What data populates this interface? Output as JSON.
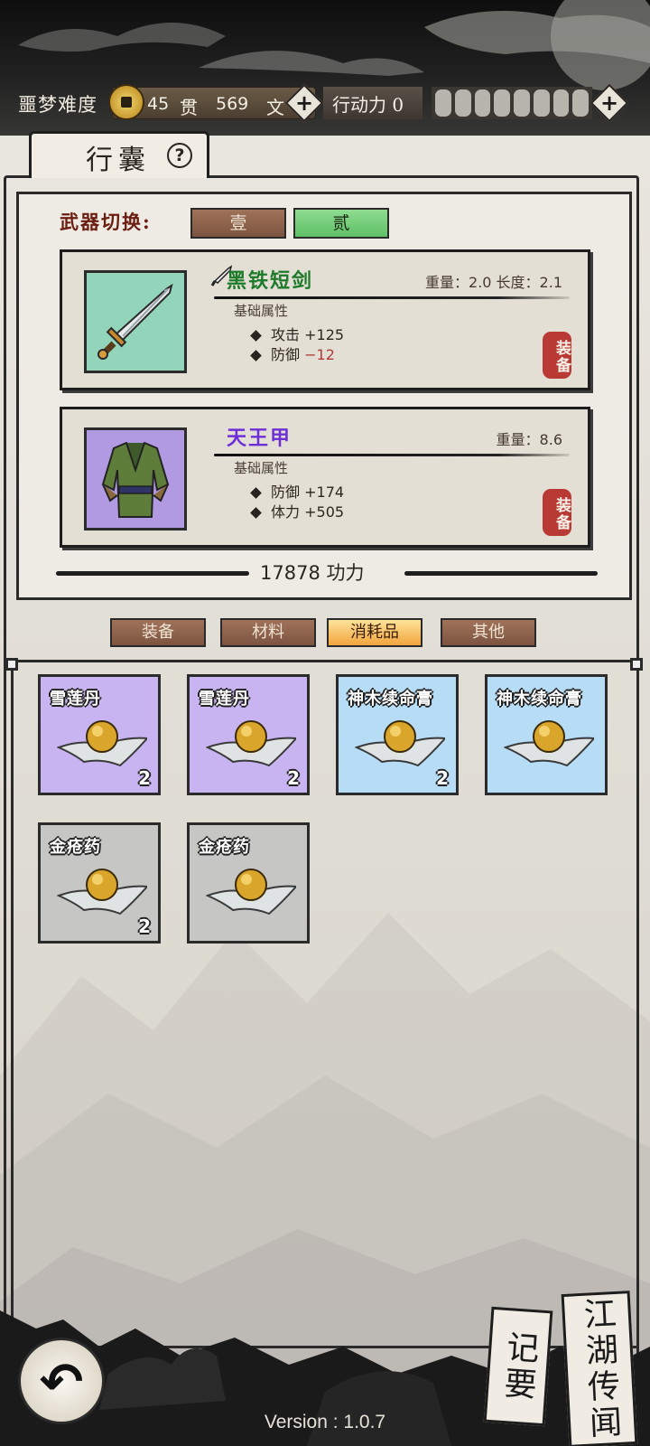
{
  "hud": {
    "difficulty": "噩梦难度",
    "coins_guan": "45",
    "coins_guan_unit": "贯",
    "coins_wen": "569",
    "coins_wen_unit": "文",
    "action_label": "行动力 0",
    "stamina_filled": 0,
    "stamina_slots": 8
  },
  "panel": {
    "title": "行囊",
    "help": "?",
    "weapon_switch_label": "武器切换:",
    "weapon_slots": [
      {
        "label": "壹",
        "active": false
      },
      {
        "label": "贰",
        "active": true
      }
    ]
  },
  "equipped": [
    {
      "name": "黑铁短剑",
      "meta": "重量：2.0  长度：2.1",
      "subtitle": "基础属性",
      "stats": [
        {
          "label": "攻击",
          "value": "+125"
        },
        {
          "label": "防御",
          "value": "−12"
        }
      ],
      "seal": "装备",
      "icon": "sword-icon",
      "color": "#93d5ba"
    },
    {
      "name": "天王甲",
      "meta": "重量：8.6",
      "subtitle": "基础属性",
      "stats": [
        {
          "label": "防御",
          "value": "+174"
        },
        {
          "label": "体力",
          "value": "+505"
        }
      ],
      "seal": "装备",
      "icon": "armor-icon",
      "color": "#b29ae2"
    }
  ],
  "power": "17878 功力",
  "categories": [
    {
      "label": "装备",
      "active": false
    },
    {
      "label": "材料",
      "active": false
    },
    {
      "label": "消耗品",
      "active": true
    },
    {
      "label": "其他",
      "active": false
    }
  ],
  "inventory": [
    {
      "name": "雪莲丹",
      "count": "2",
      "rarity": "purple",
      "icon": "pill-icon"
    },
    {
      "name": "雪莲丹",
      "count": "2",
      "rarity": "purple",
      "icon": "pill-icon"
    },
    {
      "name": "神木续命膏",
      "count": "2",
      "rarity": "blue",
      "icon": "pill-icon"
    },
    {
      "name": "神木续命膏",
      "count": "",
      "rarity": "blue",
      "icon": "pill-icon"
    },
    {
      "name": "金疮药",
      "count": "2",
      "rarity": "gray",
      "icon": "pill-icon"
    },
    {
      "name": "金疮药",
      "count": "",
      "rarity": "gray",
      "icon": "pill-icon"
    }
  ],
  "bottom": {
    "back_icon": "back-arrow-icon",
    "back_glyph": "↶",
    "notes": "记要",
    "rumors": "江湖传闻",
    "version": "Version : 1.0.7"
  },
  "colors": {
    "accent_orange": "#f3a43d",
    "tab_brown": "#7c5440",
    "active_green": "#5fc066",
    "seal_red": "#b93a34"
  }
}
